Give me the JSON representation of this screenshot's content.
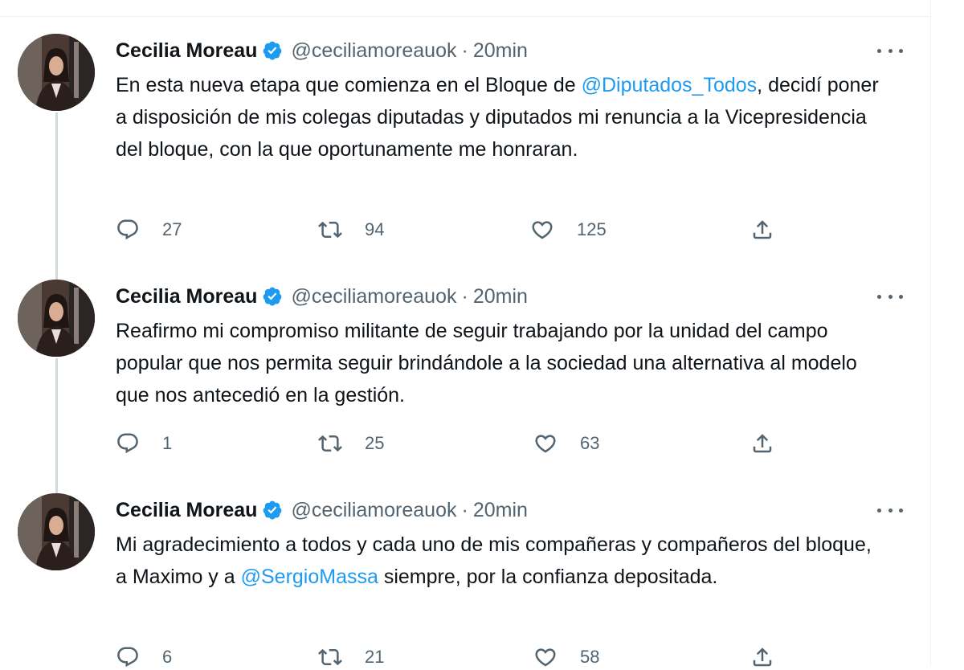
{
  "colors": {
    "accent": "#1d9bf0",
    "text": "#0f1419",
    "secondary": "#536471"
  },
  "tweets": [
    {
      "name": "Cecilia Moreau",
      "handle": "@ceciliamoreauok",
      "separator": "·",
      "time": "20min",
      "text_before": "En esta nueva etapa que comienza en el Bloque de ",
      "mention": "@Diputados_Todos",
      "text_after": ", decidí poner a disposición de mis colegas diputadas y diputados mi renuncia a la Vicepresidencia del bloque, con la que oportunamente me honraran.",
      "replies": "27",
      "retweets": "94",
      "likes": "125"
    },
    {
      "name": "Cecilia Moreau",
      "handle": "@ceciliamoreauok",
      "separator": "·",
      "time": "20min",
      "text_before": "Reafirmo mi compromiso militante de seguir trabajando por la unidad del campo popular que nos permita seguir brindándole a la sociedad una alternativa al modelo que nos antecedió en la gestión.",
      "mention": "",
      "text_after": "",
      "replies": "1",
      "retweets": "25",
      "likes": "63"
    },
    {
      "name": "Cecilia Moreau",
      "handle": "@ceciliamoreauok",
      "separator": "·",
      "time": "20min",
      "text_before": "Mi agradecimiento a todos y cada uno de mis compañeras y compañeros del bloque, a Maximo y a ",
      "mention": "@SergioMassa",
      "text_after": " siempre, por la confianza depositada.",
      "replies": "6",
      "retweets": "21",
      "likes": "58"
    }
  ]
}
